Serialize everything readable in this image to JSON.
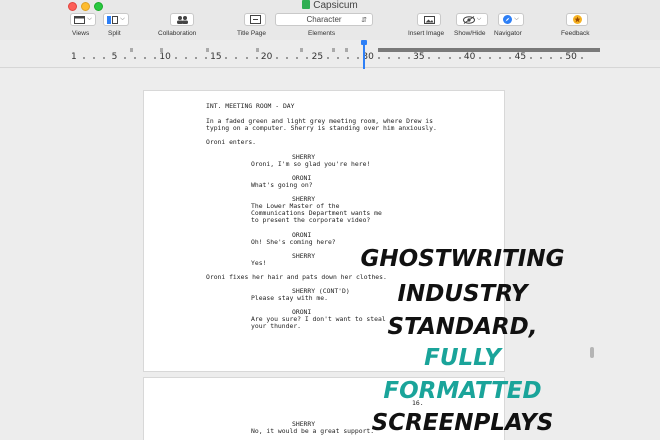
{
  "window": {
    "title": "Capsicum"
  },
  "toolbar": {
    "views_label": "Views",
    "split_label": "Split",
    "collaboration_label": "Collaboration",
    "title_page_label": "Title Page",
    "elements_value": "Character",
    "elements_label": "Elements",
    "insert_image_label": "Insert Image",
    "show_hide_label": "Show/Hide",
    "navigator_label": "Navigator",
    "feedback_label": "Feedback"
  },
  "ruler": {
    "numbers": [
      "1",
      "5",
      "10",
      "15",
      "20",
      "25",
      "30",
      "35",
      "40",
      "45",
      "50"
    ]
  },
  "script": {
    "scene_heading": "INT. MEETING ROOM - DAY",
    "action1_line1": "In a faded green and light grey meeting room, where Drew is",
    "action1_line2": "typing on a computer. Sherry is standing over him anxiously.",
    "action2": "Oroni enters.",
    "char1": "SHERRY",
    "dial1": "Oroni, I'm so glad you're here!",
    "char2": "ORONI",
    "dial2": "What's going on?",
    "char3": "SHERRY",
    "dial3_line1": "The Lower Master of the",
    "dial3_line2": "Communications Department wants me",
    "dial3_line3": "to present the corporate video?",
    "char4": "ORONI",
    "dial4": "Oh! She's coming here?",
    "char5": "SHERRY",
    "dial5": "Yes!",
    "action3": "Oroni fixes her hair and pats down her clothes.",
    "char6": "SHERRY (CONT'D)",
    "dial6": "Please stay with me.",
    "char7": "ORONI",
    "dial7_line1": "Are you sure? I don't want to steal",
    "dial7_line2": "your thunder.",
    "page_number": "16.",
    "char8": "SHERRY",
    "dial8": "No, it would be a great support."
  },
  "promo": {
    "line1": "GHOSTWRITING",
    "line2": "INDUSTRY",
    "line3": "STANDARD,",
    "line4": "FULLY",
    "line5": "FORMATTED",
    "line6": "SCREENPLAYS",
    "colors": {
      "black": "#111111",
      "teal": "#1aa49a"
    }
  },
  "colors": {
    "accent": "#2d7ff6"
  }
}
